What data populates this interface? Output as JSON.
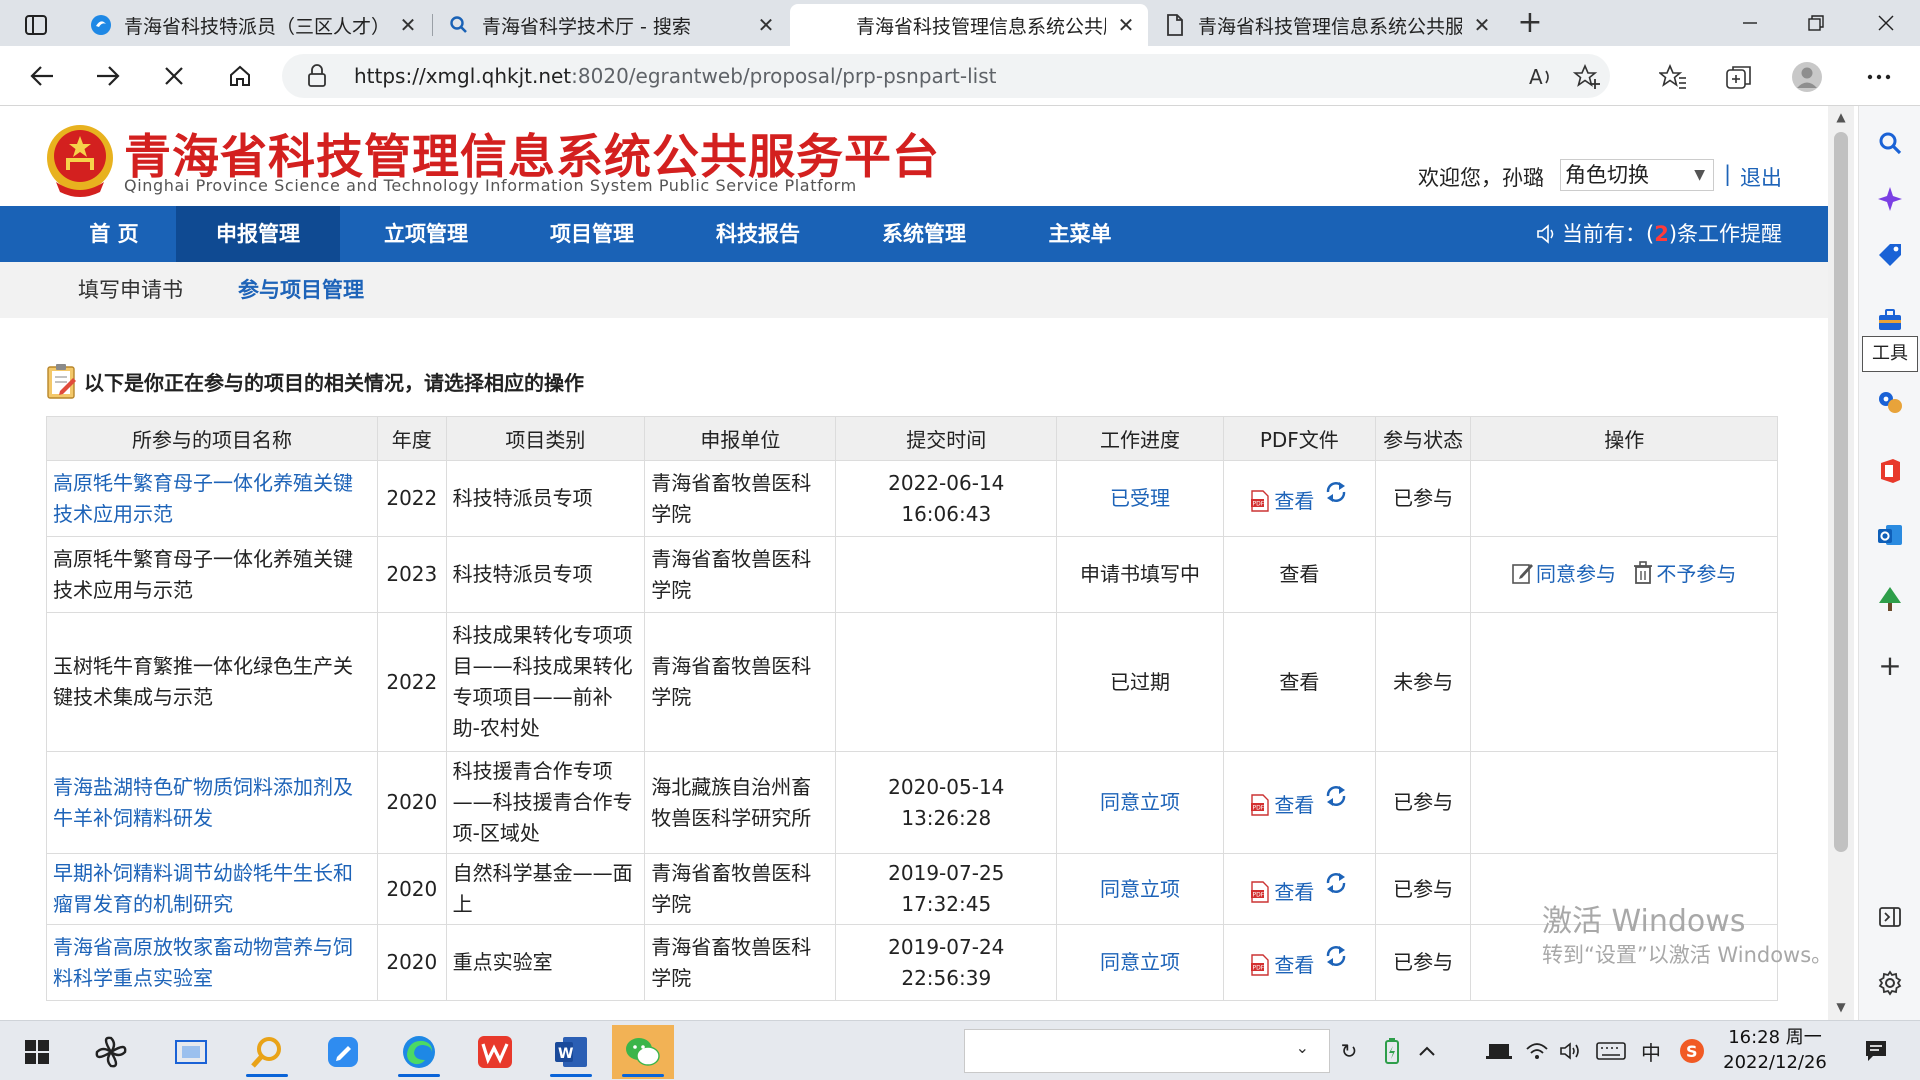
{
  "browser": {
    "tabs": [
      {
        "title": "青海省科技特派员（三区人才）星",
        "active": false
      },
      {
        "title": "青海省科学技术厅 - 搜索",
        "active": false
      },
      {
        "title": "青海省科技管理信息系统公共服务",
        "active": true
      },
      {
        "title": "青海省科技管理信息系统公共服务",
        "active": false
      }
    ],
    "url_host": "https://xmgl.qhkjt.net",
    "url_path": ":8020/egrantweb/proposal/prp-psnpart-list",
    "sidebar_tooltip": "工具"
  },
  "header": {
    "title": "青海省科技管理信息系统公共服务平台",
    "subtitle": "Qinghai Province Science and Technology Information System Public Service Platform",
    "welcome": "欢迎您，孙璐",
    "role_select": "角色切换",
    "divider": "|",
    "logout": "退出"
  },
  "nav": {
    "items": [
      "首 页",
      "申报管理",
      "立项管理",
      "项目管理",
      "科技报告",
      "系统管理",
      "主菜单"
    ],
    "active_index": 1,
    "reminder_prefix": "当前有：(",
    "reminder_count": "2",
    "reminder_suffix": ")条工作提醒"
  },
  "subnav": {
    "items": [
      "填写申请书",
      "参与项目管理"
    ],
    "active_index": 1
  },
  "section_title": "以下是你正在参与的项目的相关情况，请选择相应的操作",
  "table": {
    "headers": [
      "所参与的项目名称",
      "年度",
      "项目类别",
      "申报单位",
      "提交时间",
      "工作进度",
      "PDF文件",
      "参与状态",
      "操作"
    ],
    "rows": [
      {
        "name": "高原牦牛繁育母子一体化养殖关键技术应用示范",
        "name_link": true,
        "year": "2022",
        "category": "科技特派员专项",
        "unit": "青海省畜牧兽医科学院",
        "submit_time": "2022-06-14 16:06:43",
        "progress": "已受理",
        "progress_link": true,
        "pdf": "查看",
        "pdf_link": true,
        "status": "已参与",
        "actions": []
      },
      {
        "name": "高原牦牛繁育母子一体化养殖关键技术应用与示范",
        "name_link": false,
        "year": "2023",
        "category": "科技特派员专项",
        "unit": "青海省畜牧兽医科学院",
        "submit_time": "",
        "progress": "申请书填写中",
        "progress_link": false,
        "pdf": "查看",
        "pdf_link": false,
        "status": "",
        "actions": [
          "同意参与",
          "不予参与"
        ]
      },
      {
        "name": "玉树牦牛育繁推一体化绿色生产关键技术集成与示范",
        "name_link": false,
        "year": "2022",
        "category": "科技成果转化专项项目——科技成果转化专项项目——前补助-农村处",
        "unit": "青海省畜牧兽医科学院",
        "submit_time": "",
        "progress": "已过期",
        "progress_link": false,
        "pdf": "查看",
        "pdf_link": false,
        "status": "未参与",
        "actions": []
      },
      {
        "name": "青海盐湖特色矿物质饲料添加剂及牛羊补饲精料研发",
        "name_link": true,
        "year": "2020",
        "category": "科技援青合作专项——科技援青合作专项-区域处",
        "unit": "海北藏族自治州畜牧兽医科学研究所",
        "submit_time": "2020-05-14 13:26:28",
        "progress": "同意立项",
        "progress_link": true,
        "pdf": "查看",
        "pdf_link": true,
        "status": "已参与",
        "actions": []
      },
      {
        "name": "早期补饲精料调节幼龄牦牛生长和瘤胃发育的机制研究",
        "name_link": true,
        "year": "2020",
        "category": "自然科学基金——面上",
        "unit": "青海省畜牧兽医科学院",
        "submit_time": "2019-07-25 17:32:45",
        "progress": "同意立项",
        "progress_link": true,
        "pdf": "查看",
        "pdf_link": true,
        "status": "已参与",
        "actions": []
      },
      {
        "name": "青海省高原放牧家畜动物营养与饲料科学重点实验室",
        "name_link": true,
        "year": "2020",
        "category": "重点实验室",
        "unit": "青海省畜牧兽医科学院",
        "submit_time": "2019-07-24 22:56:39",
        "progress": "同意立项",
        "progress_link": true,
        "pdf": "查看",
        "pdf_link": true,
        "status": "已参与",
        "actions": []
      }
    ]
  },
  "watermark": {
    "line1": "激活 Windows",
    "line2": "转到“设置”以激活 Windows。"
  },
  "taskbar": {
    "clock_time": "16:28 周一",
    "clock_date": "2022/12/26",
    "ime": "中"
  },
  "colors": {
    "nav_blue": "#1a62b6",
    "nav_active": "#0f4a92",
    "title_red": "#d3201f",
    "link_blue": "#1d63b8"
  }
}
